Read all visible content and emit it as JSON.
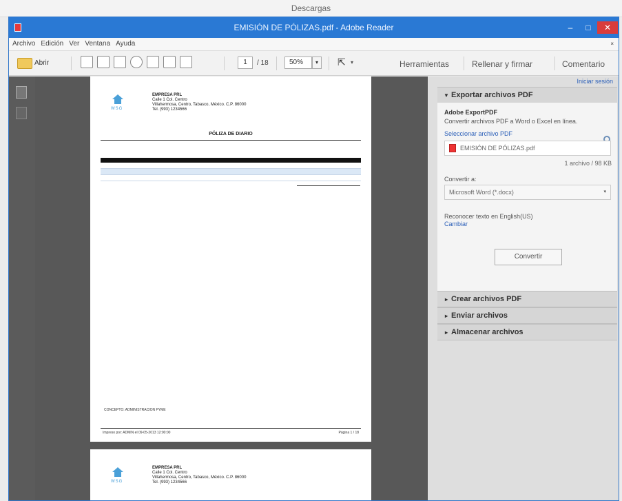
{
  "outer_window": {
    "title": "Descargas"
  },
  "window": {
    "title": "EMISIÓN DE PÓLIZAS.pdf - Adobe Reader",
    "minimize": "‒",
    "maximize": "□",
    "close": "✕"
  },
  "menu": {
    "items": [
      "Archivo",
      "Edición",
      "Ver",
      "Ventana",
      "Ayuda"
    ],
    "overflow": "×"
  },
  "toolbar": {
    "open_label": "Abrir",
    "page_current": "1",
    "page_total": "/ 18",
    "zoom": "50%",
    "zoom_arrow": "▾",
    "select_tool": "⇱",
    "select_arrow": "▾",
    "links": [
      "Herramientas",
      "Rellenar y firmar",
      "Comentario"
    ]
  },
  "panel": {
    "sign_in": "Iniciar sesión",
    "export_section": {
      "arrow": "▼",
      "title": "Exportar archivos PDF"
    },
    "service_name": "Adobe ExportPDF",
    "description": "Convertir archivos PDF a Word o Excel en línea.",
    "select_label": "Seleccionar archivo PDF",
    "file_name": "EMISIÓN DE PÓLIZAS.pdf",
    "file_count": "1 archivo / 98 KB",
    "convert_to_label": "Convertir a:",
    "convert_to_value": "Microsoft Word (*.docx)",
    "convert_arrow": "▾",
    "ocr_text": "Reconocer texto en English(US)",
    "change_link": "Cambiar",
    "convert_button": "Convertir",
    "collapsed_sections": [
      {
        "arrow": "▸",
        "title": "Crear archivos PDF"
      },
      {
        "arrow": "▸",
        "title": "Enviar archivos"
      },
      {
        "arrow": "▸",
        "title": "Almacenar archivos"
      }
    ]
  },
  "document": {
    "logo_text": "WSG",
    "company_lines": [
      "EMPRESA PRL",
      "Calle 1 Col. Centro",
      "Villahermosa, Centro, Tabasco, México. C.P. 86000",
      "Tel. (993) 1234566"
    ],
    "title": "PÓLIZA DE DIARIO",
    "footer_left": "Impreso por: ADMIN el 09-05-2013 12:00:00",
    "footer_right": "Página 1 / 18",
    "concept": "CONCEPTO: ADMINISTRACION PYME"
  },
  "colors": {
    "titlebar": "#2a79d4",
    "close": "#d93c3c",
    "link": "#2b5fb8",
    "doc_background": "#585858"
  }
}
